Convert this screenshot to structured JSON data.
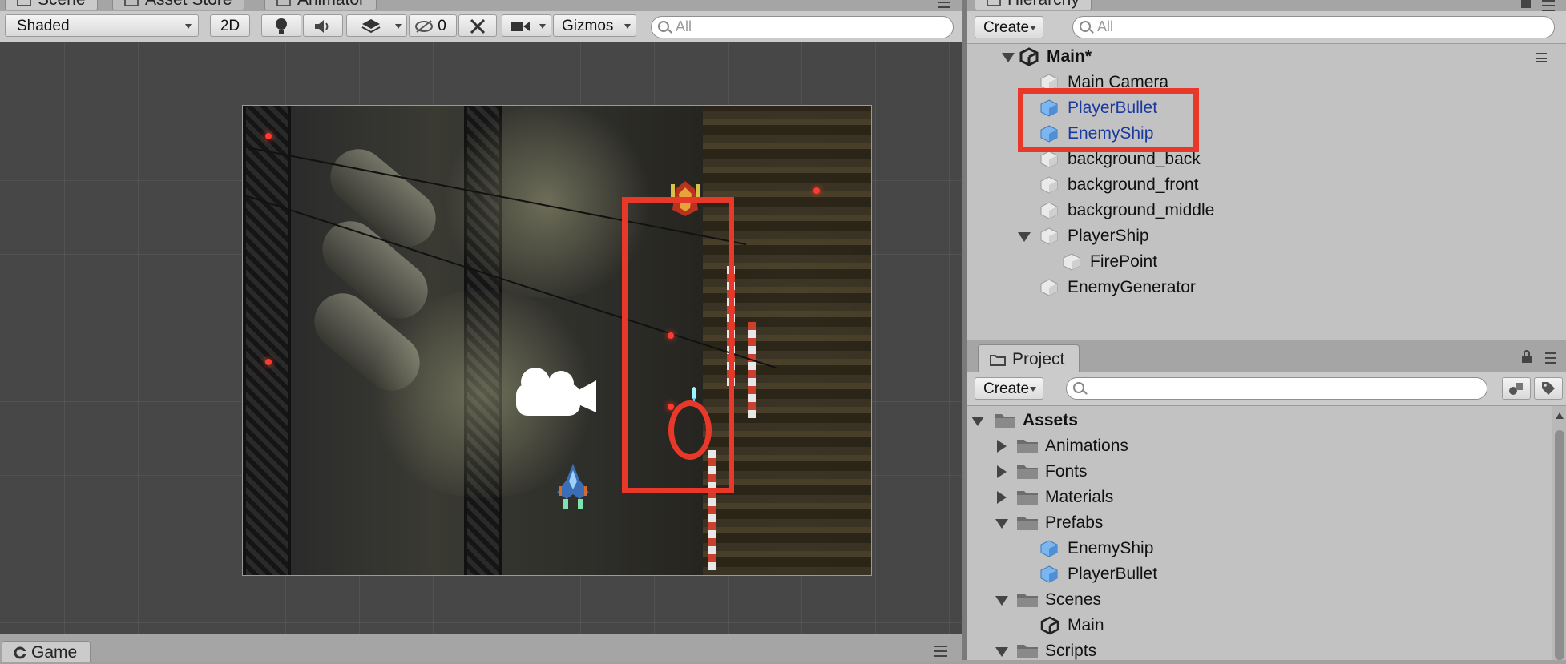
{
  "scene": {
    "tabs": [
      {
        "label": "Scene",
        "active": true
      },
      {
        "label": "Asset Store",
        "active": false
      },
      {
        "label": "Animator",
        "active": false
      }
    ],
    "toolbar": {
      "shading_mode": "Shaded",
      "mode_2d": "2D",
      "hidden_count": "0",
      "gizmos_label": "Gizmos",
      "search_placeholder": "All"
    }
  },
  "game": {
    "tab_label": "Game"
  },
  "hierarchy": {
    "tab_label": "Hierarchy",
    "create_label": "Create",
    "search_placeholder": "All",
    "scene_name": "Main*",
    "items": [
      {
        "label": "Main Camera",
        "type": "gameobject",
        "selected": false
      },
      {
        "label": "PlayerBullet",
        "type": "prefab",
        "selected": true
      },
      {
        "label": "EnemyShip",
        "type": "prefab",
        "selected": true
      },
      {
        "label": "background_back",
        "type": "gameobject",
        "selected": false
      },
      {
        "label": "background_front",
        "type": "gameobject",
        "selected": false
      },
      {
        "label": "background_middle",
        "type": "gameobject",
        "selected": false
      },
      {
        "label": "PlayerShip",
        "type": "gameobject",
        "expanded": true
      },
      {
        "label": "FirePoint",
        "type": "gameobject",
        "child": true
      },
      {
        "label": "EnemyGenerator",
        "type": "gameobject",
        "selected": false
      }
    ]
  },
  "project": {
    "tab_label": "Project",
    "create_label": "Create",
    "search_placeholder": "",
    "root": "Assets",
    "items": [
      {
        "label": "Animations",
        "kind": "folder",
        "expanded": false
      },
      {
        "label": "Fonts",
        "kind": "folder",
        "expanded": false
      },
      {
        "label": "Materials",
        "kind": "folder",
        "expanded": false
      },
      {
        "label": "Prefabs",
        "kind": "folder",
        "expanded": true
      },
      {
        "label": "EnemyShip",
        "kind": "prefab"
      },
      {
        "label": "PlayerBullet",
        "kind": "prefab"
      },
      {
        "label": "Scenes",
        "kind": "folder",
        "expanded": true
      },
      {
        "label": "Main",
        "kind": "scene"
      },
      {
        "label": "Scripts",
        "kind": "folder",
        "expanded": true
      }
    ]
  },
  "colors": {
    "highlight": "#e8382a",
    "selection_text": "#1b3aa0",
    "prefab_cube": "#5b9be0"
  }
}
